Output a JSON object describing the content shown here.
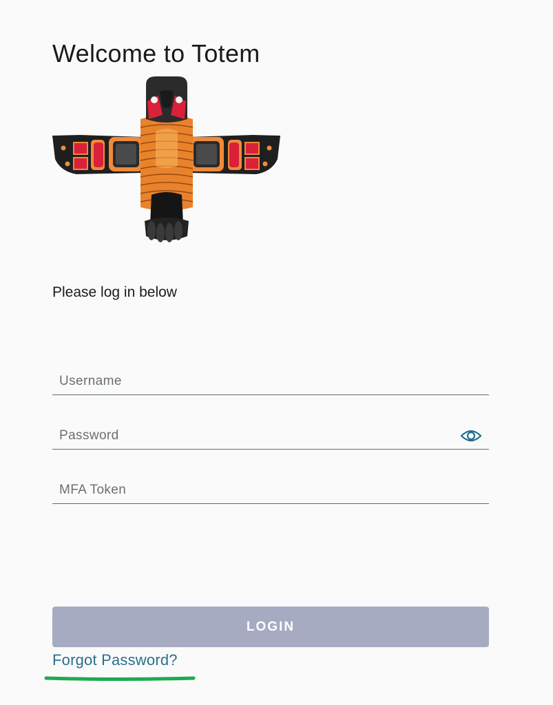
{
  "header": {
    "title": "Welcome to Totem",
    "subtitle": "Please log in below"
  },
  "form": {
    "username_placeholder": "Username",
    "username_value": "",
    "password_placeholder": "Password",
    "password_value": "",
    "mfa_placeholder": "MFA Token",
    "mfa_value": "",
    "show_password_icon": "eye-icon"
  },
  "actions": {
    "login_label": "LOGIN",
    "forgot_label": "Forgot Password?"
  },
  "colors": {
    "background": "#fafafa",
    "login_button": "#a6abc2",
    "link": "#2a6f8e",
    "accent_underline": "#1eaa4f",
    "field_border": "#5b6e6e"
  }
}
